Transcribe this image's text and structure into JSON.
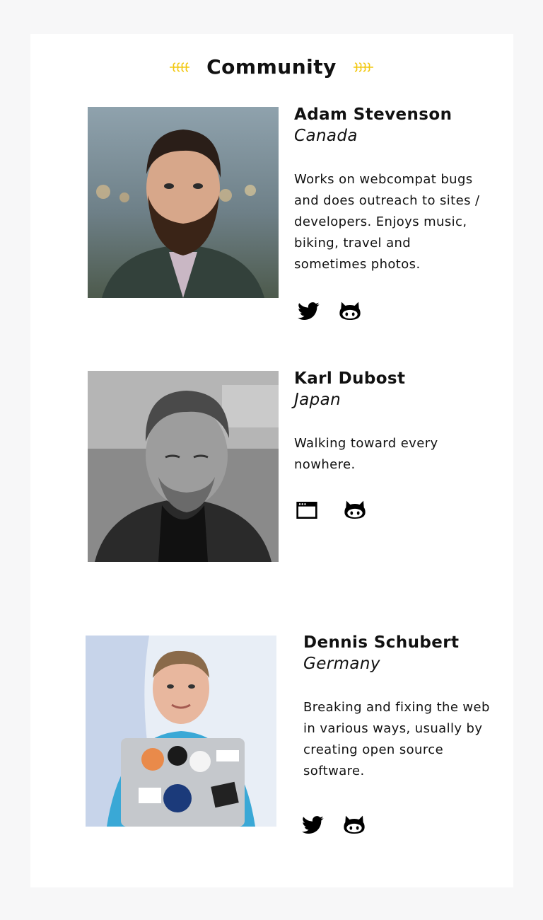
{
  "section": {
    "title": "Community"
  },
  "members": [
    {
      "name": "Adam Stevenson",
      "country": "Canada",
      "bio": "Works on webcompat bugs and does outreach to sites / developers. Enjoys music, biking, travel and sometimes photos.",
      "links": [
        "twitter-icon",
        "github-icon"
      ]
    },
    {
      "name": "Karl Dubost",
      "country": "Japan",
      "bio": "Walking toward every nowhere.",
      "links": [
        "website-icon",
        "github-icon"
      ]
    },
    {
      "name": "Dennis Schubert",
      "country": "Germany",
      "bio": "Breaking and fixing the web in various ways, usually by creating open source software.",
      "links": [
        "twitter-icon",
        "github-icon"
      ]
    }
  ],
  "colors": {
    "page_background": "#f7f7f8",
    "card_background": "#ffffff",
    "laurel_accent": "#f2c811",
    "text": "#111111"
  }
}
